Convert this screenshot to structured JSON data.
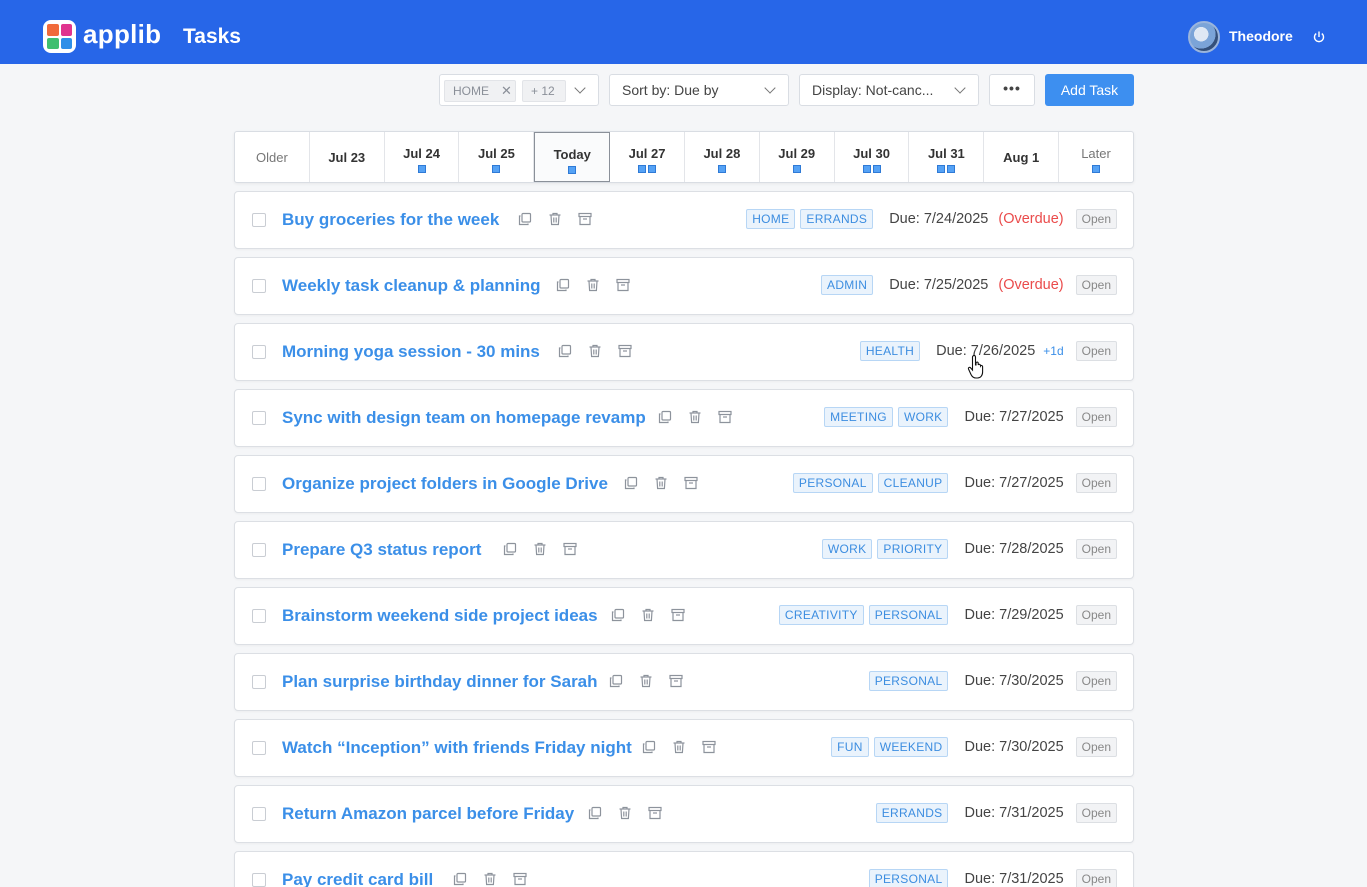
{
  "header": {
    "logo_text": "applib",
    "title": "Tasks",
    "user_name": "Theodore",
    "logo_colors": [
      "#f16a3a",
      "#e0348f",
      "#3fbf6f",
      "#2f8fe8"
    ],
    "brand_color": "#2766e8"
  },
  "toolbar": {
    "filter_chip": "HOME",
    "filter_more": "+ 12",
    "sort_label": "Sort by: Due by",
    "display_label": "Display: Not-canc...",
    "more_label": "•••",
    "add_label": "Add Task"
  },
  "date_strip": [
    {
      "label": "Older",
      "dots": 0
    },
    {
      "label": "Jul 23",
      "dots": 0
    },
    {
      "label": "Jul 24",
      "dots": 1
    },
    {
      "label": "Jul 25",
      "dots": 1
    },
    {
      "label": "Today",
      "dots": 1,
      "selected": true
    },
    {
      "label": "Jul 27",
      "dots": 2
    },
    {
      "label": "Jul 28",
      "dots": 1
    },
    {
      "label": "Jul 29",
      "dots": 1
    },
    {
      "label": "Jul 30",
      "dots": 2
    },
    {
      "label": "Jul 31",
      "dots": 2
    },
    {
      "label": "Aug 1",
      "dots": 0
    },
    {
      "label": "Later",
      "dots": 1
    }
  ],
  "tasks": [
    {
      "title": "Buy groceries for the week",
      "tags": [
        "HOME",
        "ERRANDS"
      ],
      "due": "Due: 7/24/2025",
      "overdue": "(Overdue)",
      "status": "Open"
    },
    {
      "title": "Weekly task cleanup & planning",
      "tags": [
        "ADMIN"
      ],
      "due": "Due: 7/25/2025",
      "overdue": "(Overdue)",
      "status": "Open"
    },
    {
      "title": "Morning yoga session - 30 mins",
      "tags": [
        "HEALTH"
      ],
      "due": "Due: 7/26/2025",
      "extra": "+1d",
      "status": "Open"
    },
    {
      "title": "Sync with design team on homepage revamp",
      "tags": [
        "MEETING",
        "WORK"
      ],
      "due": "Due: 7/27/2025",
      "status": "Open"
    },
    {
      "title": "Organize project folders in Google Drive",
      "tags": [
        "PERSONAL",
        "CLEANUP"
      ],
      "due": "Due: 7/27/2025",
      "status": "Open"
    },
    {
      "title": "Prepare Q3 status report",
      "tags": [
        "WORK",
        "PRIORITY"
      ],
      "due": "Due: 7/28/2025",
      "status": "Open"
    },
    {
      "title": "Brainstorm weekend side project ideas",
      "tags": [
        "CREATIVITY",
        "PERSONAL"
      ],
      "due": "Due: 7/29/2025",
      "status": "Open"
    },
    {
      "title": "Plan surprise birthday dinner for Sarah",
      "tags": [
        "PERSONAL"
      ],
      "due": "Due: 7/30/2025",
      "status": "Open"
    },
    {
      "title": "Watch “Inception” with friends Friday night",
      "tags": [
        "FUN",
        "WEEKEND"
      ],
      "due": "Due: 7/30/2025",
      "status": "Open"
    },
    {
      "title": "Return Amazon parcel before Friday",
      "tags": [
        "ERRANDS"
      ],
      "due": "Due: 7/31/2025",
      "status": "Open"
    },
    {
      "title": "Pay credit card bill",
      "tags": [
        "PERSONAL"
      ],
      "due": "Due: 7/31/2025",
      "status": "Open"
    }
  ]
}
